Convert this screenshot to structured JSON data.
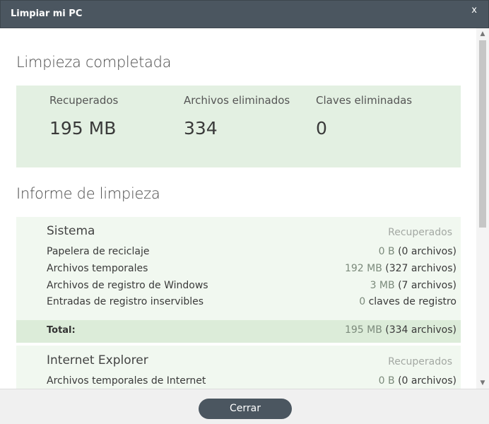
{
  "window": {
    "title": "Limpiar mi PC",
    "close_glyph": "x"
  },
  "completed": {
    "heading": "Limpieza completada",
    "stats": [
      {
        "label": "Recuperados",
        "value": "195 MB"
      },
      {
        "label": "Archivos eliminados",
        "value": "334"
      },
      {
        "label": "Claves eliminadas",
        "value": "0"
      }
    ]
  },
  "report": {
    "heading": "Informe de limpieza",
    "sections": [
      {
        "title": "Sistema",
        "recovered_label": "Recuperados",
        "rows": [
          {
            "label": "Papelera de reciclaje",
            "amount": "0 B",
            "count": "(0 archivos)"
          },
          {
            "label": "Archivos temporales",
            "amount": "192 MB",
            "count": "(327 archivos)"
          },
          {
            "label": "Archivos de registro de Windows",
            "amount": "3 MB",
            "count": "(7 archivos)"
          },
          {
            "label": "Entradas de registro inservibles",
            "amount": "0",
            "count": "claves de registro"
          }
        ],
        "total": {
          "label": "Total:",
          "amount": "195 MB",
          "count": "(334 archivos)"
        }
      },
      {
        "title": "Internet Explorer",
        "recovered_label": "Recuperados",
        "rows": [
          {
            "label": "Archivos temporales de Internet",
            "amount": "0 B",
            "count": "(0 archivos)"
          }
        ]
      }
    ]
  },
  "footer": {
    "close_button": "Cerrar"
  },
  "scrollbar": {
    "up_icon": "chevron-up-icon",
    "down_icon": "chevron-down-icon"
  }
}
